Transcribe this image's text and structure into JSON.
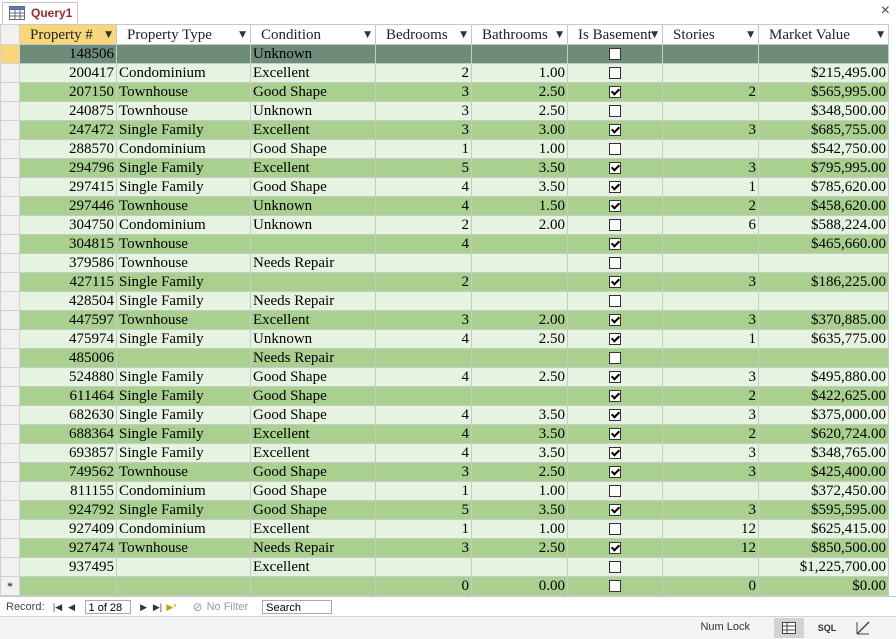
{
  "tab": {
    "title": "Query1"
  },
  "columns": [
    "Property #",
    "Property Type",
    "Condition",
    "Bedrooms",
    "Bathrooms",
    "Is Basement",
    "Stories",
    "Market Value"
  ],
  "rows": [
    {
      "id": "148506",
      "type": "",
      "cond": "Unknown",
      "bed": "",
      "bath": "",
      "base": false,
      "stories": "",
      "value": ""
    },
    {
      "id": "200417",
      "type": "Condominium",
      "cond": "Excellent",
      "bed": "2",
      "bath": "1.00",
      "base": false,
      "stories": "",
      "value": "$215,495.00"
    },
    {
      "id": "207150",
      "type": "Townhouse",
      "cond": "Good Shape",
      "bed": "3",
      "bath": "2.50",
      "base": true,
      "stories": "2",
      "value": "$565,995.00"
    },
    {
      "id": "240875",
      "type": "Townhouse",
      "cond": "Unknown",
      "bed": "3",
      "bath": "2.50",
      "base": false,
      "stories": "",
      "value": "$348,500.00"
    },
    {
      "id": "247472",
      "type": "Single Family",
      "cond": "Excellent",
      "bed": "3",
      "bath": "3.00",
      "base": true,
      "stories": "3",
      "value": "$685,755.00"
    },
    {
      "id": "288570",
      "type": "Condominium",
      "cond": "Good Shape",
      "bed": "1",
      "bath": "1.00",
      "base": false,
      "stories": "",
      "value": "$542,750.00"
    },
    {
      "id": "294796",
      "type": "Single Family",
      "cond": "Excellent",
      "bed": "5",
      "bath": "3.50",
      "base": true,
      "stories": "3",
      "value": "$795,995.00"
    },
    {
      "id": "297415",
      "type": "Single Family",
      "cond": "Good Shape",
      "bed": "4",
      "bath": "3.50",
      "base": true,
      "stories": "1",
      "value": "$785,620.00"
    },
    {
      "id": "297446",
      "type": "Townhouse",
      "cond": "Unknown",
      "bed": "4",
      "bath": "1.50",
      "base": true,
      "stories": "2",
      "value": "$458,620.00"
    },
    {
      "id": "304750",
      "type": "Condominium",
      "cond": "Unknown",
      "bed": "2",
      "bath": "2.00",
      "base": false,
      "stories": "6",
      "value": "$588,224.00"
    },
    {
      "id": "304815",
      "type": "Townhouse",
      "cond": "",
      "bed": "4",
      "bath": "",
      "base": true,
      "stories": "",
      "value": "$465,660.00"
    },
    {
      "id": "379586",
      "type": "Townhouse",
      "cond": "Needs Repair",
      "bed": "",
      "bath": "",
      "base": false,
      "stories": "",
      "value": ""
    },
    {
      "id": "427115",
      "type": "Single Family",
      "cond": "",
      "bed": "2",
      "bath": "",
      "base": true,
      "stories": "3",
      "value": "$186,225.00"
    },
    {
      "id": "428504",
      "type": "Single Family",
      "cond": "Needs Repair",
      "bed": "",
      "bath": "",
      "base": false,
      "stories": "",
      "value": ""
    },
    {
      "id": "447597",
      "type": "Townhouse",
      "cond": "Excellent",
      "bed": "3",
      "bath": "2.00",
      "base": true,
      "stories": "3",
      "value": "$370,885.00"
    },
    {
      "id": "475974",
      "type": "Single Family",
      "cond": "Unknown",
      "bed": "4",
      "bath": "2.50",
      "base": true,
      "stories": "1",
      "value": "$635,775.00"
    },
    {
      "id": "485006",
      "type": "",
      "cond": "Needs Repair",
      "bed": "",
      "bath": "",
      "base": false,
      "stories": "",
      "value": ""
    },
    {
      "id": "524880",
      "type": "Single Family",
      "cond": "Good Shape",
      "bed": "4",
      "bath": "2.50",
      "base": true,
      "stories": "3",
      "value": "$495,880.00"
    },
    {
      "id": "611464",
      "type": "Single Family",
      "cond": "Good Shape",
      "bed": "",
      "bath": "",
      "base": true,
      "stories": "2",
      "value": "$422,625.00"
    },
    {
      "id": "682630",
      "type": "Single Family",
      "cond": "Good Shape",
      "bed": "4",
      "bath": "3.50",
      "base": true,
      "stories": "3",
      "value": "$375,000.00"
    },
    {
      "id": "688364",
      "type": "Single Family",
      "cond": "Excellent",
      "bed": "4",
      "bath": "3.50",
      "base": true,
      "stories": "2",
      "value": "$620,724.00"
    },
    {
      "id": "693857",
      "type": "Single Family",
      "cond": "Excellent",
      "bed": "4",
      "bath": "3.50",
      "base": true,
      "stories": "3",
      "value": "$348,765.00"
    },
    {
      "id": "749562",
      "type": "Townhouse",
      "cond": "Good Shape",
      "bed": "3",
      "bath": "2.50",
      "base": true,
      "stories": "3",
      "value": "$425,400.00"
    },
    {
      "id": "811155",
      "type": "Condominium",
      "cond": "Good Shape",
      "bed": "1",
      "bath": "1.00",
      "base": false,
      "stories": "",
      "value": "$372,450.00"
    },
    {
      "id": "924792",
      "type": "Single Family",
      "cond": "Good Shape",
      "bed": "5",
      "bath": "3.50",
      "base": true,
      "stories": "3",
      "value": "$595,595.00"
    },
    {
      "id": "927409",
      "type": "Condominium",
      "cond": "Excellent",
      "bed": "1",
      "bath": "1.00",
      "base": false,
      "stories": "12",
      "value": "$625,415.00"
    },
    {
      "id": "927474",
      "type": "Townhouse",
      "cond": "Needs Repair",
      "bed": "3",
      "bath": "2.50",
      "base": true,
      "stories": "12",
      "value": "$850,500.00"
    },
    {
      "id": "937495",
      "type": "",
      "cond": "Excellent",
      "bed": "",
      "bath": "",
      "base": false,
      "stories": "",
      "value": "$1,225,700.00"
    }
  ],
  "new_row": {
    "marker": "*",
    "bed": "0",
    "bath": "0.00",
    "base": false,
    "stories": "0",
    "value": "$0.00"
  },
  "nav": {
    "record_label": "Record:",
    "position": "1 of 28",
    "filter_label": "No Filter",
    "search_label": "Search"
  },
  "status": {
    "numlock": "Num Lock",
    "sql_label": "SQL"
  },
  "colors": {
    "tab_title": "#a4262c",
    "row_light": "#e5f3e0",
    "row_dark": "#a9d08e",
    "row_current": "#6e8c7a",
    "header_selected": "#f7d77a"
  }
}
